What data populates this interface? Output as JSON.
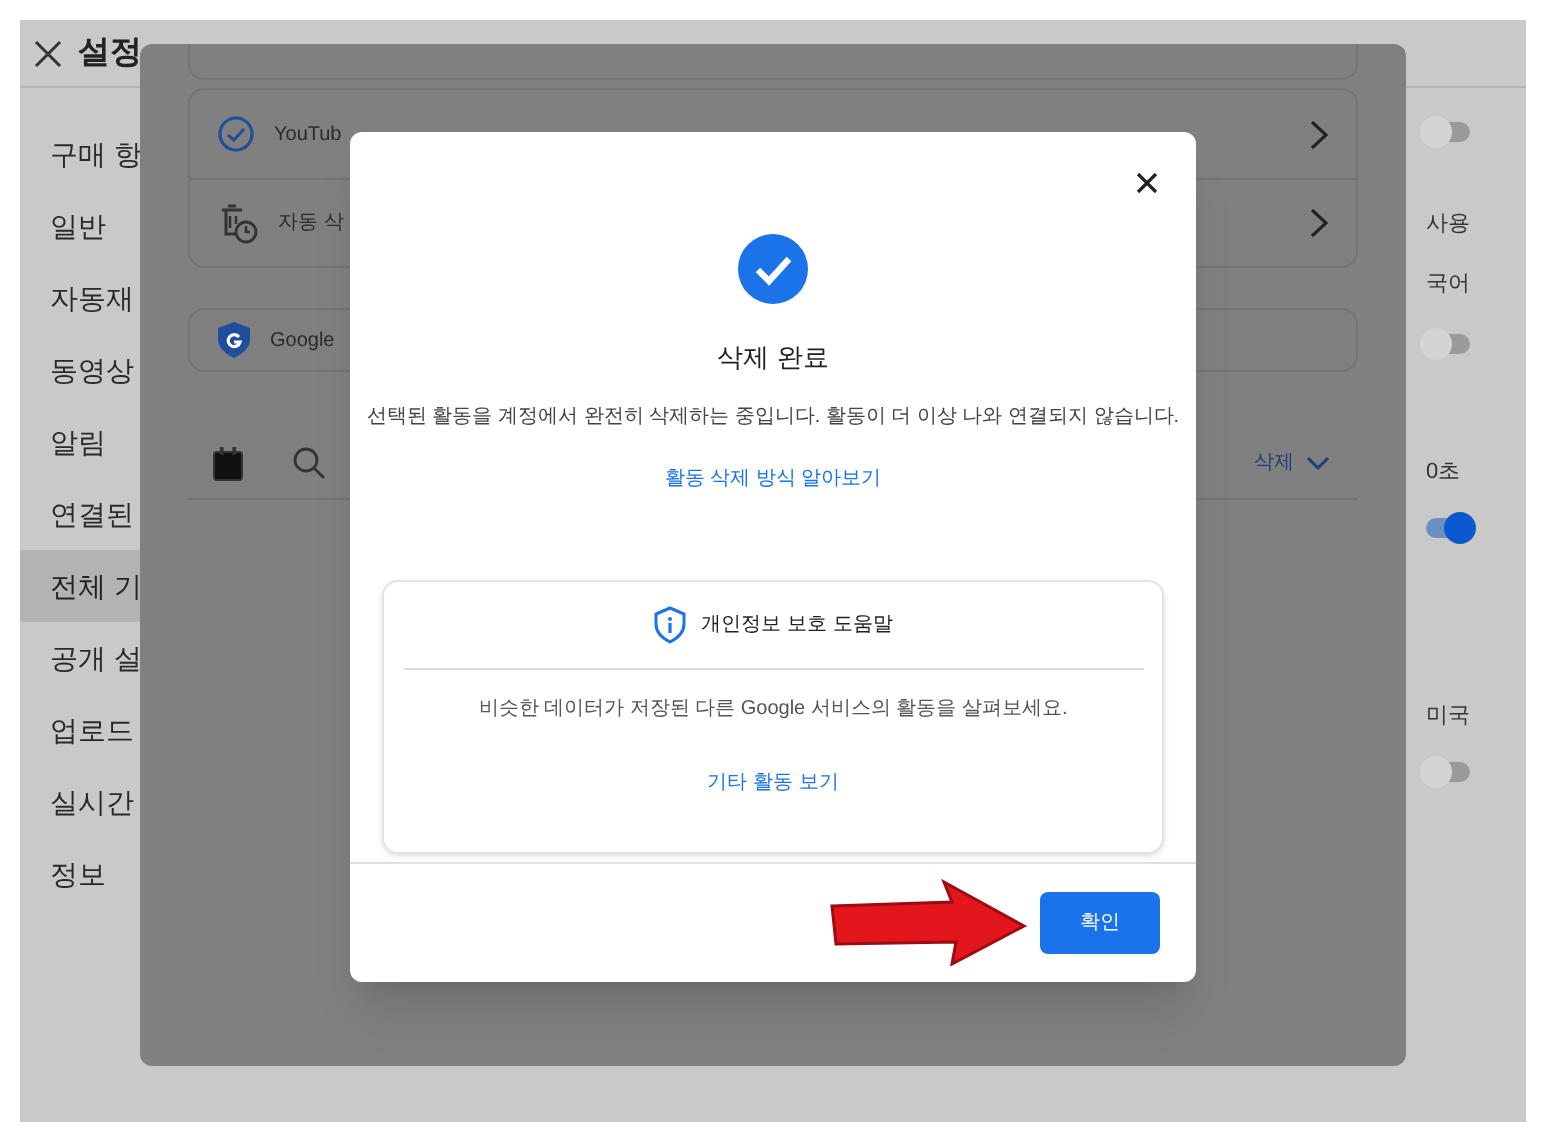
{
  "header": {
    "title": "설정"
  },
  "sidebar": {
    "items": [
      {
        "label": "구매 항",
        "selected": false
      },
      {
        "label": "일반",
        "selected": false
      },
      {
        "label": "자동재",
        "selected": false
      },
      {
        "label": "동영상",
        "selected": false
      },
      {
        "label": "알림",
        "selected": false
      },
      {
        "label": "연결된",
        "selected": false
      },
      {
        "label": "전체 기",
        "selected": true
      },
      {
        "label": "공개 설",
        "selected": false
      },
      {
        "label": "업로드",
        "selected": false
      },
      {
        "label": "실시간",
        "selected": false
      },
      {
        "label": "정보",
        "selected": false
      }
    ]
  },
  "settings_column": {
    "items": [
      {
        "kind": "toggle",
        "on": false
      },
      {
        "kind": "label",
        "text": "사용"
      },
      {
        "kind": "label",
        "text": "국어"
      },
      {
        "kind": "toggle",
        "on": false
      },
      {
        "kind": "label",
        "text": "0초"
      },
      {
        "kind": "toggle",
        "on": true
      },
      {
        "kind": "label",
        "text": "미국"
      },
      {
        "kind": "toggle",
        "on": false
      }
    ]
  },
  "activity_panel": {
    "rows": [
      {
        "kind": "history",
        "label": "YouTub"
      },
      {
        "kind": "auto_delete",
        "label": "자동 삭"
      }
    ],
    "google_card": {
      "label": "Google"
    },
    "toolbar": {
      "action": "삭제"
    }
  },
  "dialog": {
    "title": "삭제 완료",
    "message": "선택된 활동을 계정에서 완전히 삭제하는 중입니다. 활동이 더 이상 나와 연결되지 않습니다.",
    "link": "활동 삭제 방식 알아보기",
    "help_card": {
      "title": "개인정보 보호 도움말",
      "text": "비슷한 데이터가 저장된 다른 Google 서비스의 활동을 살펴보세요.",
      "link": "기타 활동 보기"
    },
    "confirm_button": "확인"
  }
}
